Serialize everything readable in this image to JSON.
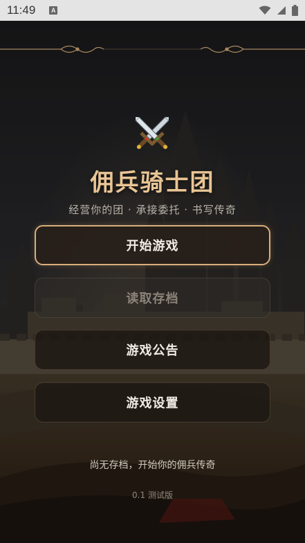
{
  "status_bar": {
    "time": "11:49",
    "notification_icon": "a-badge-icon",
    "wifi_icon": "wifi-icon",
    "signal_icon": "signal-icon",
    "battery_icon": "battery-icon"
  },
  "header": {
    "logo_icon": "crossed-swords-icon",
    "title": "佣兵骑士团",
    "subtitle": "经营你的团 · 承接委托 · 书写传奇"
  },
  "menu": {
    "start": "开始游戏",
    "load": "读取存档",
    "notice": "游戏公告",
    "settings": "游戏设置"
  },
  "footer": {
    "hint": "尚无存档，开始你的佣兵传奇",
    "version": "0.1 测试版"
  },
  "colors": {
    "accent_gold": "#e9c595",
    "button_border_gold": "#d9ae7c",
    "background": "#1c1c1e"
  }
}
